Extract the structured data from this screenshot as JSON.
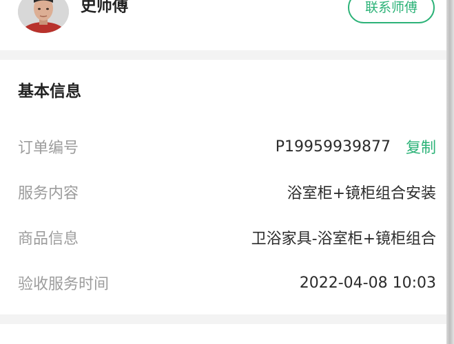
{
  "master": {
    "name": "史师傅",
    "contact_label": "联系师傅"
  },
  "basic_info": {
    "title": "基本信息",
    "rows": [
      {
        "label": "订单编号",
        "value": "P19959939877",
        "action": "复制"
      },
      {
        "label": "服务内容",
        "value": "浴室柜+镜柜组合安装"
      },
      {
        "label": "商品信息",
        "value": "卫浴家具-浴室柜+镜柜组合"
      },
      {
        "label": "验收服务时间",
        "value": "2022-04-08 10:03"
      }
    ]
  },
  "colors": {
    "accent": "#2bb277",
    "page_background": "#f3f3f3",
    "label_gray": "#9c9c9c",
    "text_dark": "#2b2b2b"
  }
}
